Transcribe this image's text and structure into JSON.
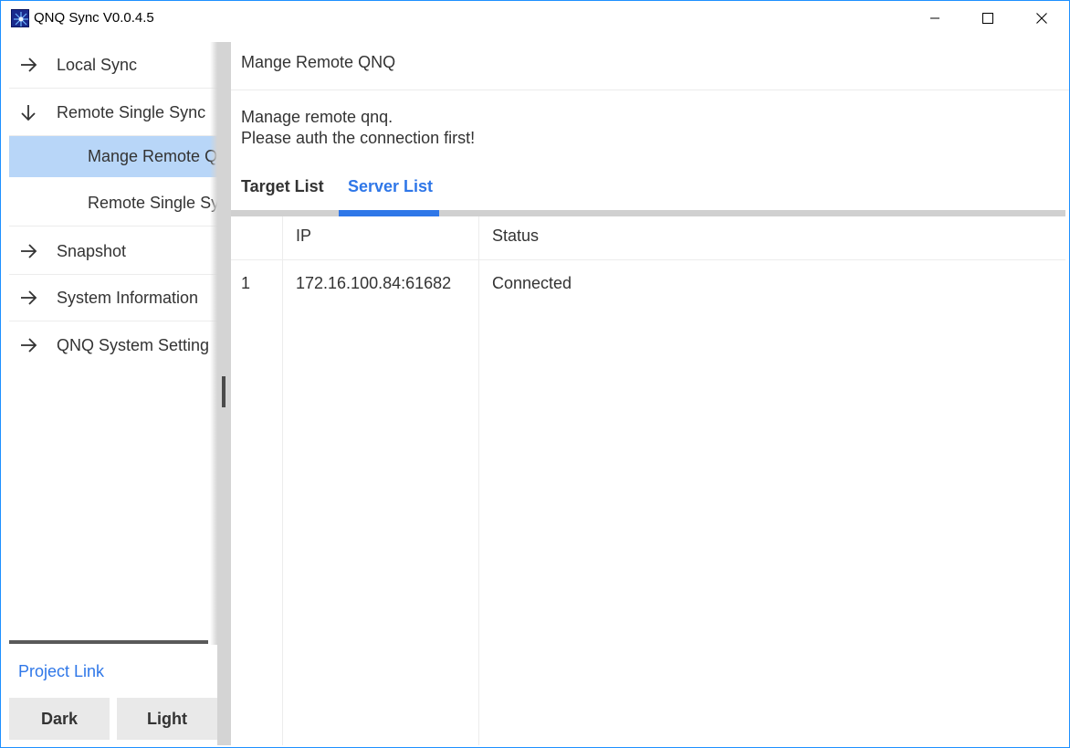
{
  "window": {
    "title": "QNQ Sync V0.0.4.5",
    "controls": [
      "minimize",
      "maximize",
      "close"
    ]
  },
  "sidebar": {
    "items": [
      {
        "label": "Local Sync",
        "icon": "arrow-right-icon"
      },
      {
        "label": "Remote Single Sync",
        "icon": "arrow-down-icon"
      },
      {
        "label": "Mange Remote QNQ",
        "active": true
      },
      {
        "label": "Remote Single Sync"
      },
      {
        "label": "Snapshot",
        "icon": "arrow-right-icon"
      },
      {
        "label": "System Information",
        "icon": "arrow-right-icon"
      },
      {
        "label": "QNQ System Setting",
        "icon": "arrow-right-icon"
      }
    ],
    "project_link": "Project Link",
    "theme_buttons": {
      "dark": "Dark",
      "light": "Light"
    }
  },
  "main": {
    "title": "Mange Remote QNQ",
    "description_line1": "Manage remote qnq.",
    "description_line2": "Please auth the connection first!",
    "tabs": [
      {
        "label": "Target List",
        "active": false
      },
      {
        "label": "Server List",
        "active": true
      }
    ],
    "table": {
      "columns": [
        "",
        "IP",
        "Status"
      ],
      "rows": [
        {
          "index": "1",
          "ip": "172.16.100.84:61682",
          "status": "Connected"
        }
      ]
    }
  },
  "colors": {
    "accent": "#2f77e8",
    "active_nav_bg": "#b8d6f8",
    "window_border": "#1e90ff"
  }
}
